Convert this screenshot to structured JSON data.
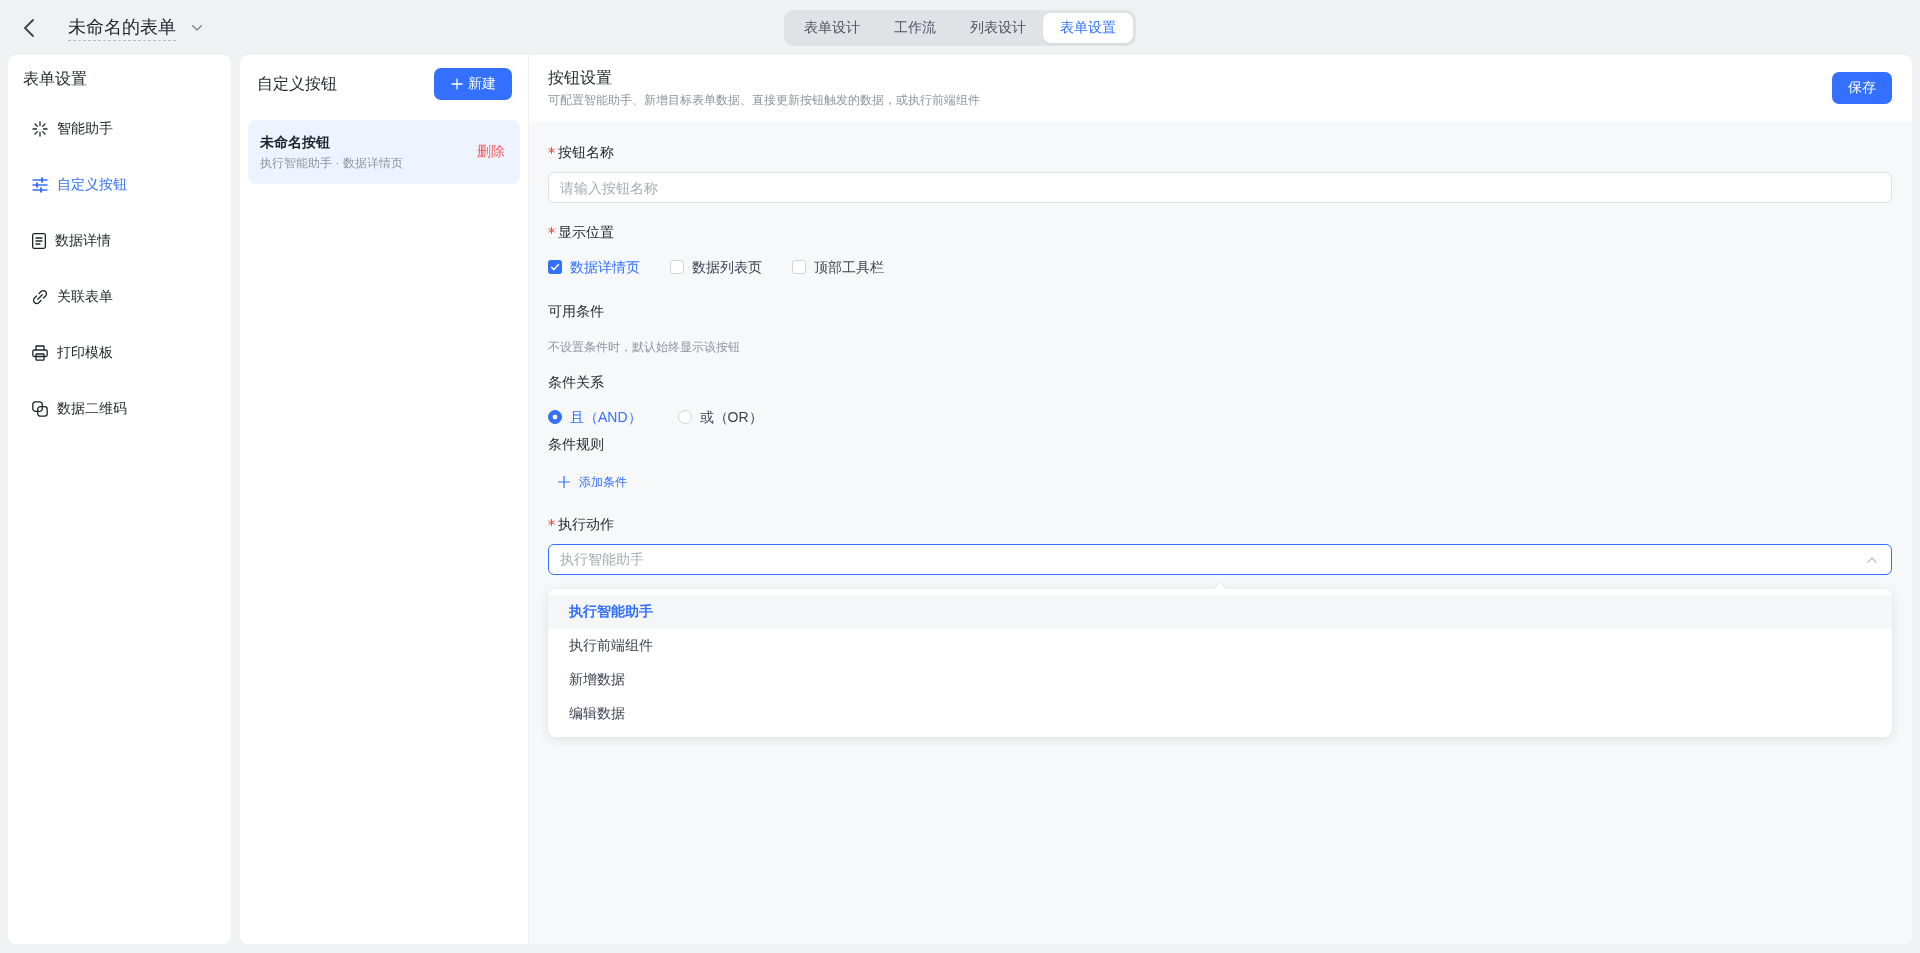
{
  "top_bar": {
    "title": "未命名的表单",
    "tabs": [
      {
        "label": "表单设计",
        "selected": false
      },
      {
        "label": "工作流",
        "selected": false
      },
      {
        "label": "列表设计",
        "selected": false
      },
      {
        "label": "表单设置",
        "selected": true
      }
    ]
  },
  "sidebar": {
    "title": "表单设置",
    "items": [
      {
        "label": "智能助手",
        "selected": false
      },
      {
        "label": "自定义按钮",
        "selected": true
      },
      {
        "label": "数据详情",
        "selected": false
      },
      {
        "label": "关联表单",
        "selected": false
      },
      {
        "label": "打印模板",
        "selected": false
      },
      {
        "label": "数据二维码",
        "selected": false
      }
    ]
  },
  "button_list": {
    "title": "自定义按钮",
    "new_button": "新建",
    "items": [
      {
        "name": "未命名按钮",
        "summary": "执行智能助手 · 数据详情页",
        "delete": "删除",
        "selected": true
      }
    ]
  },
  "settings": {
    "title": "按钮设置",
    "description": "可配置智能助手、新增目标表单数据、直接更新按钮触发的数据，或执行前端组件",
    "save": "保存",
    "name_field": {
      "label": "按钮名称",
      "required": true,
      "placeholder": "请输入按钮名称"
    },
    "position_field": {
      "label": "显示位置",
      "required": true,
      "options": [
        {
          "label": "数据详情页",
          "checked": true
        },
        {
          "label": "数据列表页",
          "checked": false
        },
        {
          "label": "顶部工具栏",
          "checked": false
        }
      ]
    },
    "conditions": {
      "label": "可用条件",
      "hint": "不设置条件时，默认始终显示该按钮"
    },
    "relation_field": {
      "label": "条件关系",
      "options": [
        {
          "label": "且（AND）",
          "selected": true
        },
        {
          "label": "或（OR）",
          "selected": false
        }
      ]
    },
    "rules_field": {
      "label": "条件规则",
      "add_button": "添加条件"
    },
    "action_field": {
      "label": "执行动作",
      "required": true,
      "placeholder": "执行智能助手",
      "expanded": true,
      "options": [
        {
          "label": "执行智能助手",
          "selected": true
        },
        {
          "label": "执行前端组件",
          "selected": false
        },
        {
          "label": "新增数据",
          "selected": false
        },
        {
          "label": "编辑数据",
          "selected": false
        }
      ]
    }
  }
}
